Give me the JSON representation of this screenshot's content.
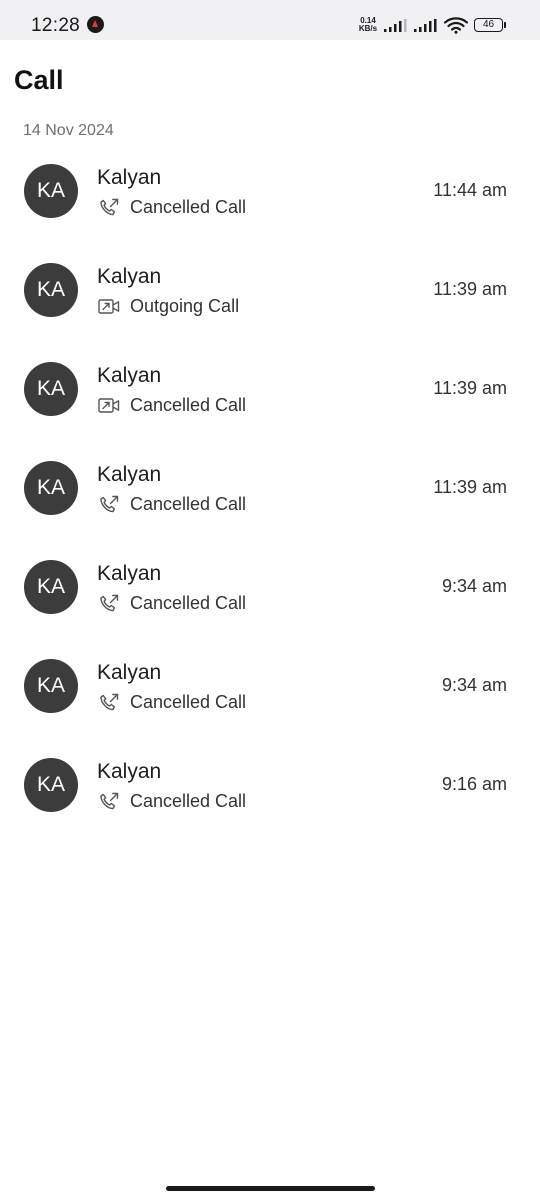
{
  "status_bar": {
    "time": "12:28",
    "app_icon": "notification-app-icon",
    "net_speed_value": "0.14",
    "net_speed_unit": "KB/s",
    "battery": "46"
  },
  "header": {
    "title": "Call"
  },
  "date_group": "14 Nov 2024",
  "colors": {
    "avatar_bg": "#3c3c3c",
    "status_bar_bg": "#f1f1f4"
  },
  "calls": [
    {
      "initials": "KA",
      "name": "Kalyan",
      "icon": "voice-call-icon",
      "status": "Cancelled Call",
      "time": "11:44 am"
    },
    {
      "initials": "KA",
      "name": "Kalyan",
      "icon": "video-call-icon",
      "status": "Outgoing Call",
      "time": "11:39 am"
    },
    {
      "initials": "KA",
      "name": "Kalyan",
      "icon": "video-call-icon",
      "status": "Cancelled Call",
      "time": "11:39 am"
    },
    {
      "initials": "KA",
      "name": "Kalyan",
      "icon": "voice-call-icon",
      "status": "Cancelled Call",
      "time": "11:39 am"
    },
    {
      "initials": "KA",
      "name": "Kalyan",
      "icon": "voice-call-icon",
      "status": "Cancelled Call",
      "time": "9:34 am"
    },
    {
      "initials": "KA",
      "name": "Kalyan",
      "icon": "voice-call-icon",
      "status": "Cancelled Call",
      "time": "9:34 am"
    },
    {
      "initials": "KA",
      "name": "Kalyan",
      "icon": "voice-call-icon",
      "status": "Cancelled Call",
      "time": "9:16 am"
    }
  ]
}
